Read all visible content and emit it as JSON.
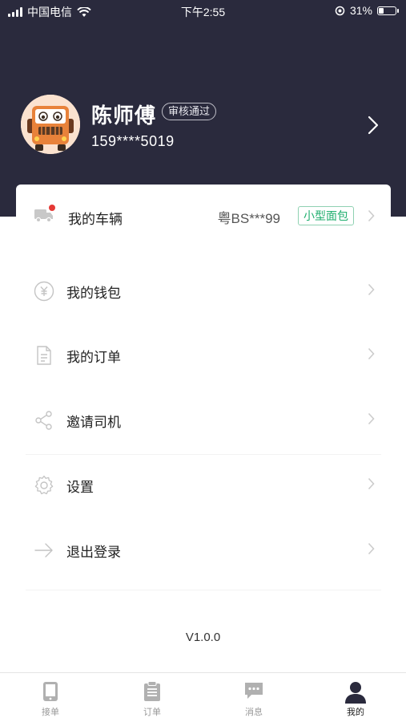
{
  "status_bar": {
    "carrier": "中国电信",
    "time": "下午2:55",
    "battery": "31%",
    "battery_level": 0.31
  },
  "profile": {
    "name": "陈师傅",
    "badge": "审核通过",
    "phone": "159****5019"
  },
  "vehicle": {
    "label": "我的车辆",
    "plate": "粤BS***99",
    "type": "小型面包"
  },
  "menu": {
    "wallet": "我的钱包",
    "orders": "我的订单",
    "invite": "邀请司机",
    "settings": "设置",
    "logout": "退出登录"
  },
  "version": "V1.0.0",
  "tabbar": {
    "tabs": [
      {
        "label": "接单",
        "icon": "phone-icon"
      },
      {
        "label": "订单",
        "icon": "clipboard-icon"
      },
      {
        "label": "消息",
        "icon": "message-icon"
      },
      {
        "label": "我的",
        "icon": "user-icon"
      }
    ],
    "active": "我的"
  },
  "colors": {
    "header_bg": "#2a2a3d",
    "accent_green": "#1fae6e",
    "badge_red": "#e53935"
  }
}
